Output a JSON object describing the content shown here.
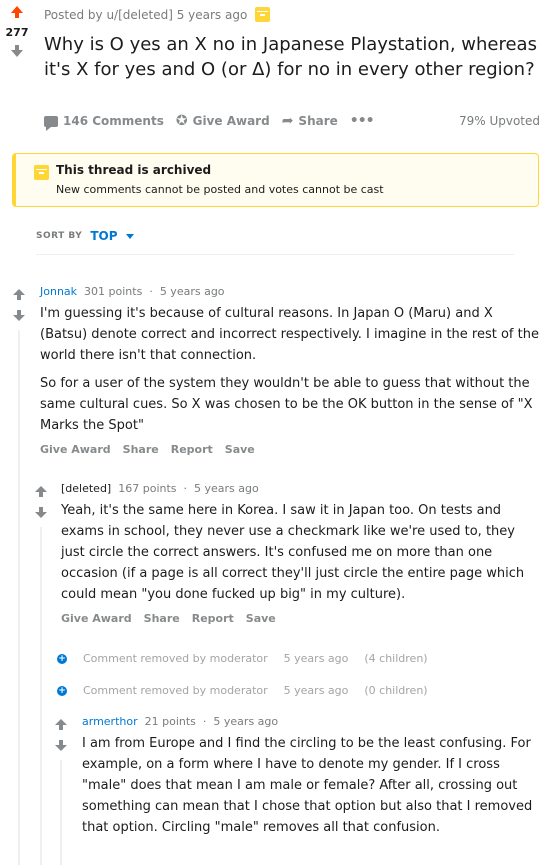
{
  "post": {
    "score": "277",
    "meta": "Posted by u/[deleted] 5 years ago",
    "title": "Why is O yes an X no in Japanese Playstation, whereas it's X for yes and O (or Δ) for no in every other region?",
    "comments_label": "146 Comments",
    "give_award": "Give Award",
    "share": "Share",
    "more": "•••",
    "upvoted": "79% Upvoted"
  },
  "archived": {
    "title": "This thread is archived",
    "text": "New comments cannot be posted and votes cannot be cast"
  },
  "sort": {
    "label": "SORT BY",
    "value": "TOP"
  },
  "comments": [
    {
      "author": "Jonnak",
      "points": "301 points",
      "sep": "·",
      "time": "5 years ago",
      "paragraphs": [
        "I'm guessing it's because of cultural reasons. In Japan O (Maru) and X (Batsu) denote correct and incorrect respectively. I imagine in the rest of the world there isn't that connection.",
        "So for a user of the system they wouldn't be able to guess that without the same cultural cues. So X was chosen to be the OK button in the sense of \"X Marks the Spot\""
      ],
      "actions": [
        "Give Award",
        "Share",
        "Report",
        "Save"
      ]
    },
    {
      "author": "[deleted]",
      "points": "167 points",
      "sep": "·",
      "time": "5 years ago",
      "paragraphs": [
        "Yeah, it's the same here in Korea. I saw it in Japan too. On tests and exams in school, they never use a checkmark like we're used to, they just circle the correct answers. It's confused me on more than one occasion (if a page is all correct they'll just circle the entire page which could mean \"you done fucked up big\" in my culture)."
      ],
      "actions": [
        "Give Award",
        "Share",
        "Report",
        "Save"
      ]
    },
    {
      "author": "armerthor",
      "points": "21 points",
      "sep": "·",
      "time": "5 years ago",
      "paragraphs": [
        "I am from Europe and I find the circling to be the least confusing. For example, on a form where I have to denote my gender. If I cross \"male\" does that mean I am male or female? After all, crossing out something can mean that I chose that option but also that I removed that option. Circling \"male\" removes all that confusion."
      ]
    }
  ],
  "removed": [
    {
      "text": "Comment removed by moderator",
      "time": "5 years ago",
      "children": "(4 children)"
    },
    {
      "text": "Comment removed by moderator",
      "time": "5 years ago",
      "children": "(0 children)"
    }
  ]
}
